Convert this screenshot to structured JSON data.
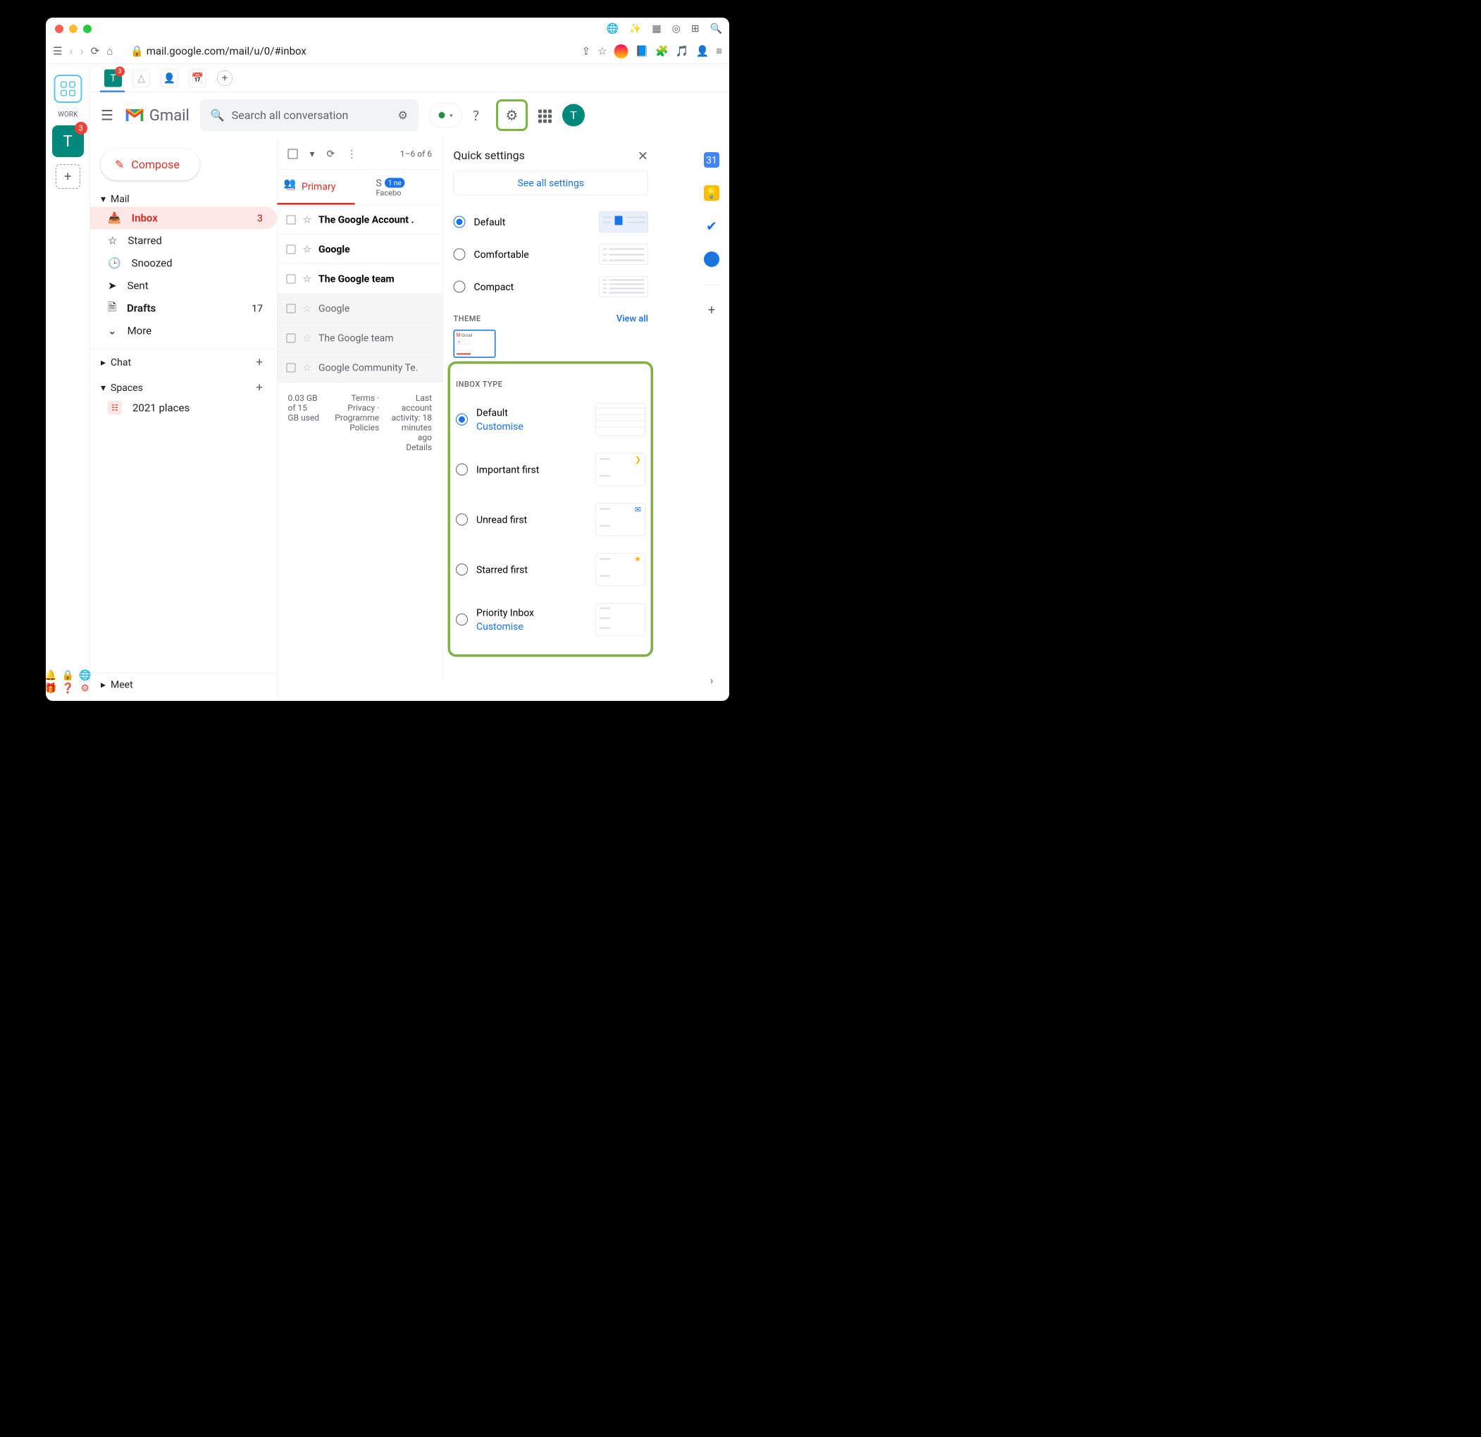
{
  "browser": {
    "url": "mail.google.com/mail/u/0/#inbox"
  },
  "workspace": {
    "label": "WORK",
    "badge": "3"
  },
  "gmail": {
    "name": "Gmail",
    "search_placeholder": "Search all conversation",
    "compose": "Compose"
  },
  "nav": {
    "mail": "Mail",
    "inbox": "Inbox",
    "inbox_count": "3",
    "starred": "Starred",
    "snoozed": "Snoozed",
    "sent": "Sent",
    "drafts": "Drafts",
    "drafts_count": "17",
    "more": "More",
    "chat": "Chat",
    "spaces": "Spaces",
    "space_item": "2021 places",
    "meet": "Meet"
  },
  "toolbar": {
    "range": "1–6 of 6"
  },
  "tabs": {
    "primary": "Primary",
    "social": "S",
    "social_new": "1 ne",
    "social_sub": "Facebo"
  },
  "messages": [
    {
      "from": "The Google Account .",
      "unread": true
    },
    {
      "from": "Google",
      "unread": true
    },
    {
      "from": "The Google team",
      "unread": true
    },
    {
      "from": "Google",
      "unread": false
    },
    {
      "from": "The Google team",
      "unread": false
    },
    {
      "from": "Google Community Te.",
      "unread": false
    }
  ],
  "footer": {
    "storage": "0.03 GB of 15 GB used",
    "links": "Terms · Privacy · Programme Policies",
    "activity": "Last account activity: 18 minutes ago",
    "details": "Details"
  },
  "quick_settings": {
    "title": "Quick settings",
    "see_all": "See all settings",
    "density": {
      "default": "Default",
      "comfortable": "Comfortable",
      "compact": "Compact"
    },
    "theme": {
      "label": "THEME",
      "view_all": "View all"
    },
    "inbox_type": {
      "label": "INBOX TYPE",
      "default": "Default",
      "customise": "Customise",
      "important": "Important first",
      "unread": "Unread first",
      "starred": "Starred first",
      "priority": "Priority Inbox"
    }
  },
  "avatar": "T"
}
